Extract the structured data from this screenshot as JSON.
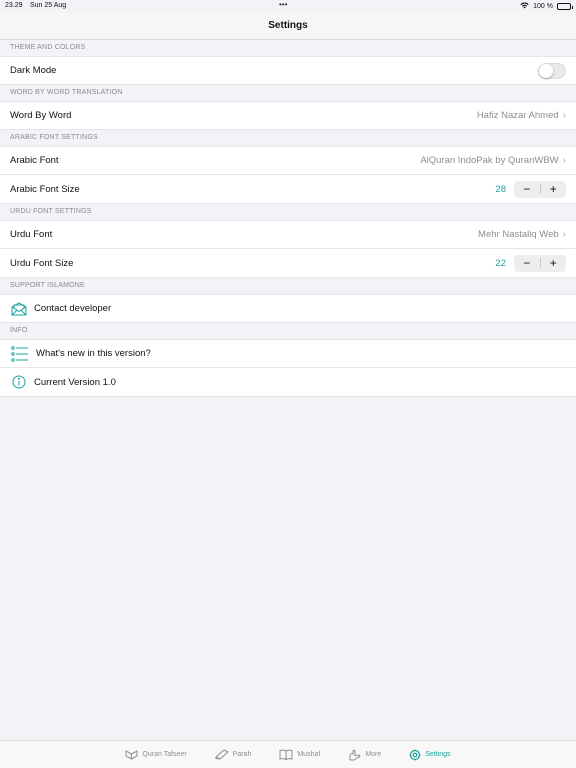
{
  "status": {
    "time": "23.29",
    "date": "Sun 25 Aug",
    "battery": "100 %",
    "dots": "•••"
  },
  "nav": {
    "title": "Settings"
  },
  "sections": {
    "theme": {
      "header": "THEME AND COLORS",
      "dark_mode_label": "Dark Mode",
      "dark_mode_on": false
    },
    "wbw": {
      "header": "WORD BY WORD TRANSLATION",
      "label": "Word By Word",
      "value": "Hafiz Nazar Ahmed"
    },
    "arabic": {
      "header": "ARABIC FONT SETTINGS",
      "font_label": "Arabic Font",
      "font_value": "AlQuran IndoPak by QuranWBW",
      "size_label": "Arabic Font Size",
      "size_value": "28"
    },
    "urdu": {
      "header": "URDU FONT SETTINGS",
      "font_label": "Urdu Font",
      "font_value": "Mehr Nastaliq Web",
      "size_label": "Urdu Font Size",
      "size_value": "22"
    },
    "support": {
      "header": "SUPPORT ISLAMONE",
      "contact_label": "Contact developer"
    },
    "info": {
      "header": "INFO",
      "whats_new_label": "What's new in this version?",
      "version_label": "Current Version 1.0"
    }
  },
  "stepper": {
    "minus": "−",
    "plus": "+"
  },
  "chevron": "›",
  "tabs": [
    {
      "label": "Quran Tafseer",
      "icon": "quran-stand-icon"
    },
    {
      "label": "Parah",
      "icon": "book-icon"
    },
    {
      "label": "Mushaf",
      "icon": "open-book-icon"
    },
    {
      "label": "More",
      "icon": "hands-icon"
    },
    {
      "label": "Settings",
      "icon": "gear-icon",
      "active": true
    }
  ],
  "colors": {
    "accent": "#1aa39e",
    "background": "#f2f2f7"
  }
}
